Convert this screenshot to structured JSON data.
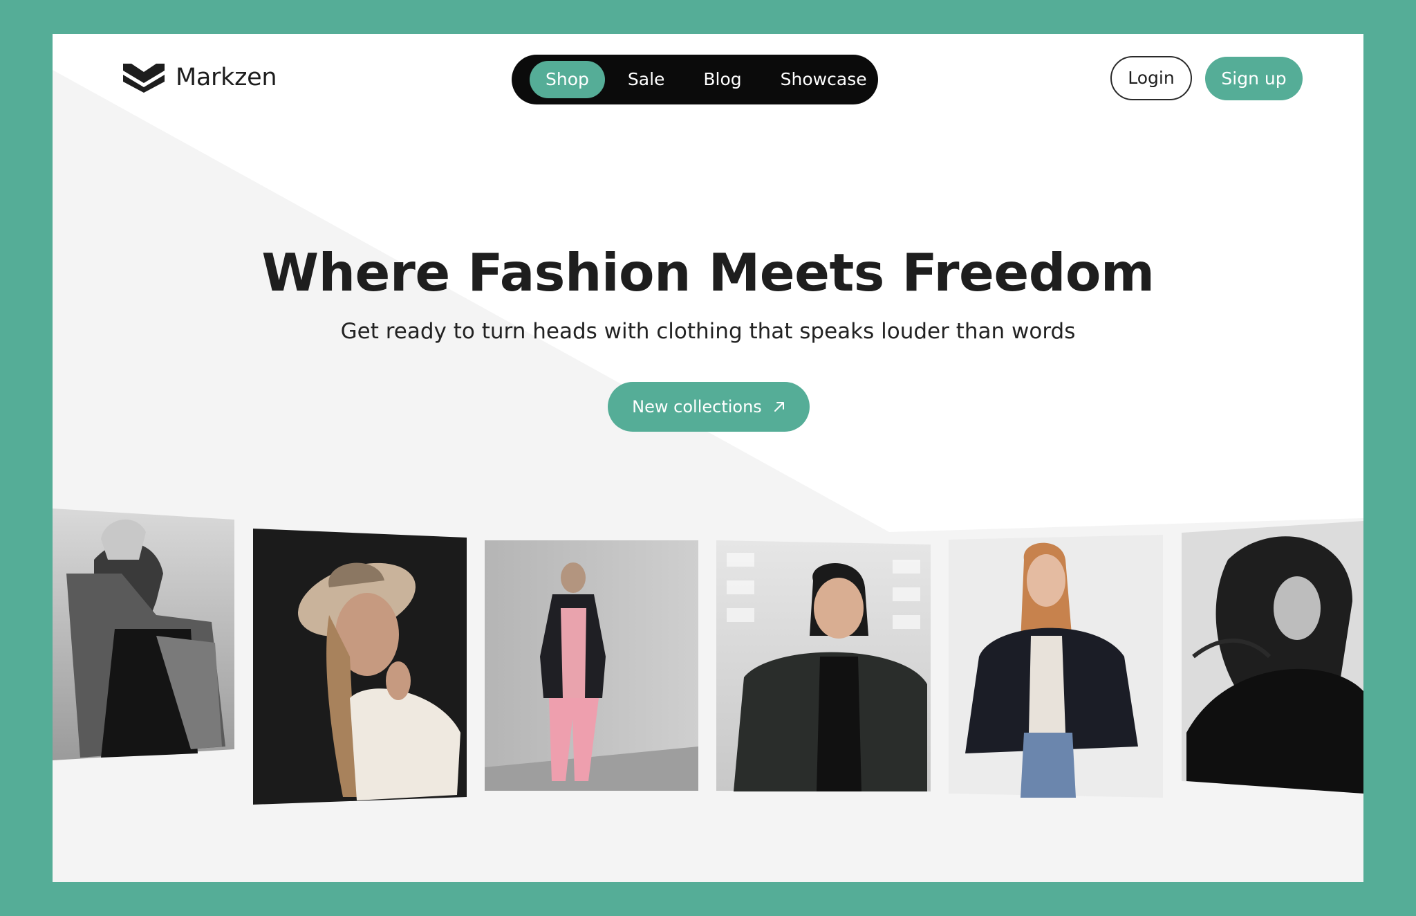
{
  "brand": {
    "name": "Markzen",
    "logo_icon": "markzen-logo-icon"
  },
  "nav": {
    "items": [
      {
        "label": "Shop",
        "active": true
      },
      {
        "label": "Sale",
        "active": false
      },
      {
        "label": "Blog",
        "active": false
      },
      {
        "label": "Showcase",
        "active": false
      }
    ]
  },
  "auth": {
    "login_label": "Login",
    "signup_label": "Sign up"
  },
  "hero": {
    "title": "Where Fashion Meets Freedom",
    "subtitle": "Get ready to turn heads with clothing that speaks louder than words",
    "cta_label": "New collections",
    "cta_icon": "arrow-up-right-icon"
  },
  "gallery": {
    "photos": [
      {
        "subject": "fashion-photo-1",
        "tone": "monochrome"
      },
      {
        "subject": "fashion-photo-2",
        "tone": "color"
      },
      {
        "subject": "fashion-photo-3",
        "tone": "color"
      },
      {
        "subject": "fashion-photo-4",
        "tone": "color"
      },
      {
        "subject": "fashion-photo-5",
        "tone": "color"
      },
      {
        "subject": "fashion-photo-6",
        "tone": "monochrome"
      }
    ]
  },
  "colors": {
    "accent": "#55ad97",
    "frame": "#55ad97",
    "nav_background": "#0b0b0b",
    "text": "#1e1e1e",
    "panel": "#f4f4f4"
  }
}
